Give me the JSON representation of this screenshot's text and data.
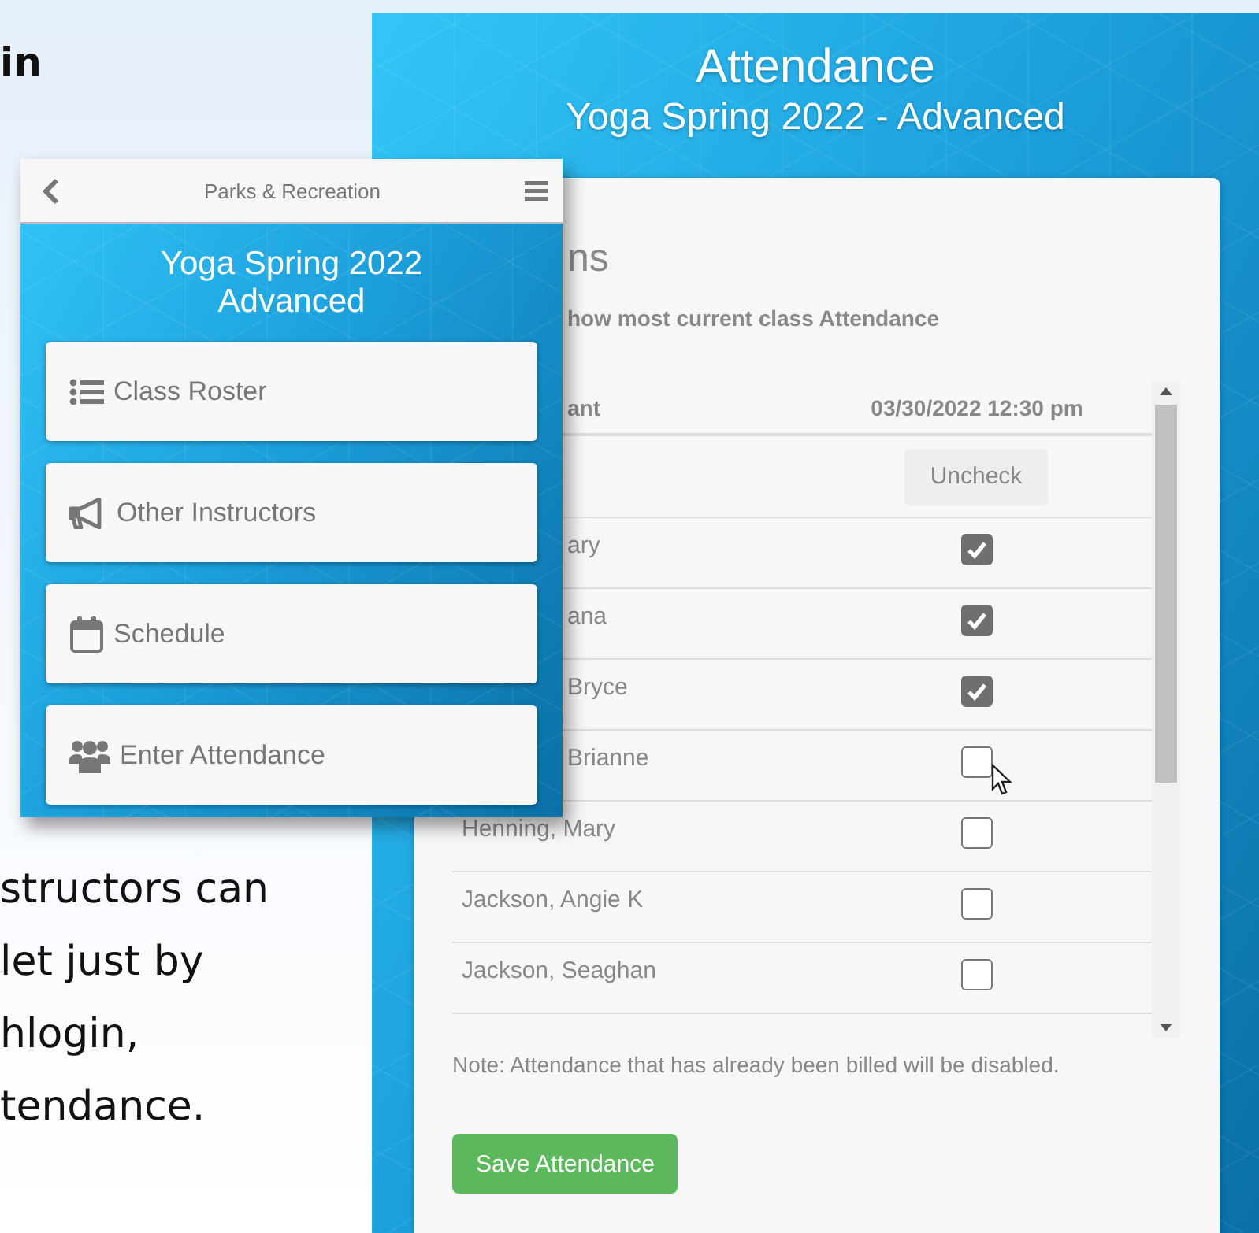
{
  "promo": {
    "heading": "in",
    "paragraph_lines": [
      "structors can",
      "let just by",
      "hlogin,",
      "tendance."
    ]
  },
  "attendance": {
    "title": "Attendance",
    "subtitle": "Yoga Spring 2022 - Advanced",
    "section_heading": "ns",
    "instruction": "how most current class Attendance",
    "columns": [
      "ant",
      "03/30/2022 12:30 pm"
    ],
    "header_action": "Uncheck",
    "rows": [
      {
        "name": "ary",
        "checked": true
      },
      {
        "name": "ana",
        "checked": true
      },
      {
        "name": "Bryce",
        "checked": true
      },
      {
        "name": "Brianne",
        "checked": false
      },
      {
        "name": "Henning, Mary",
        "checked": false
      },
      {
        "name": "Jackson, Angie K",
        "checked": false
      },
      {
        "name": "Jackson, Seaghan",
        "checked": false
      }
    ],
    "note": "Note: Attendance that has already been billed will be disabled.",
    "save_button": "Save Attendance"
  },
  "phone": {
    "header_title": "Parks & Recreation",
    "title_lines": [
      "Yoga Spring 2022",
      "Advanced"
    ],
    "menu": [
      {
        "label": "Class Roster",
        "kind": "list"
      },
      {
        "label": "Other Instructors",
        "kind": "megaphone"
      },
      {
        "label": "Schedule",
        "kind": "calendar"
      },
      {
        "label": "Enter Attendance",
        "kind": "group"
      }
    ]
  }
}
